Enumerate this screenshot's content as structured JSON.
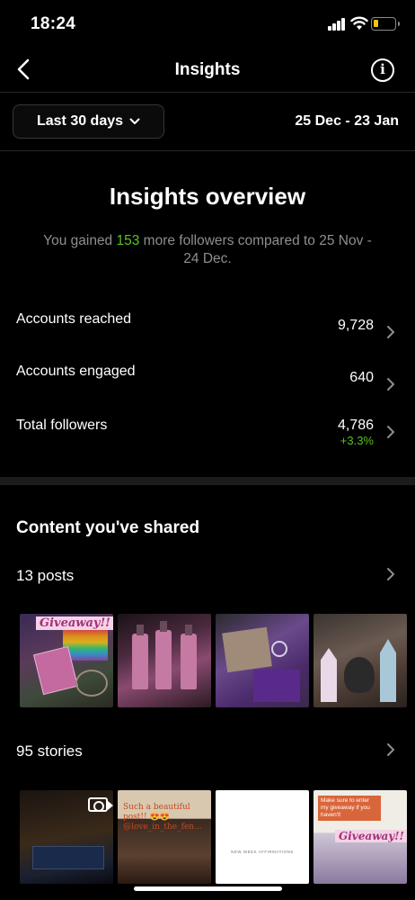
{
  "status_bar": {
    "time": "18:24"
  },
  "nav": {
    "title": "Insights"
  },
  "period": {
    "label": "Last 30 days",
    "range": "25 Dec - 23 Jan"
  },
  "overview": {
    "title": "Insights overview",
    "subtitle_before": "You gained ",
    "subtitle_value": "153",
    "subtitle_after": " more followers compared to 25 Nov - 24 Dec."
  },
  "metrics": [
    {
      "label": "Accounts reached",
      "value": "9,728",
      "change": ""
    },
    {
      "label": "Accounts engaged",
      "value": "640",
      "change": ""
    },
    {
      "label": "Total followers",
      "value": "4,786",
      "change": "+3.3%"
    }
  ],
  "content": {
    "title": "Content you've shared",
    "posts_label": "13 posts",
    "stories_label": "95 stories"
  },
  "thumb_text": {
    "post1_banner": "Giveaway!!",
    "story2_caption": "Such a beautiful post!! 😍😍 @love_in_the_fen...",
    "story3_caption": "NEW WEEK AFFIRMATIONS",
    "story4_caption": "Make sure to enter my giveaway if you haven't!",
    "story4_banner": "Giveaway!!"
  },
  "colors": {
    "positive": "#58c322",
    "background": "#000000"
  }
}
